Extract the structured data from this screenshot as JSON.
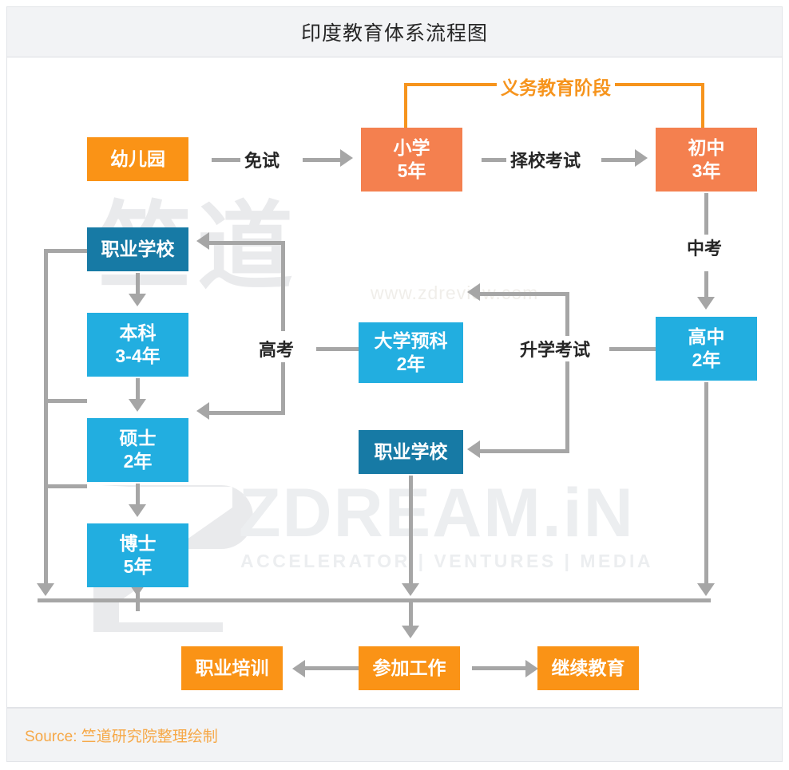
{
  "header": {
    "title": "印度教育体系流程图"
  },
  "footer": {
    "source": "Source: 竺道研究院整理绘制"
  },
  "watermark": {
    "brand_cn": "竺道",
    "brand_en": "ZDREAM.iN",
    "tagline": "ACCELERATOR | VENTURES | MEDIA",
    "url": "www.zdreview.com"
  },
  "colors": {
    "orange": "#fa9316",
    "coral": "#f4804f",
    "blue": "#22aee0",
    "dark_blue": "#177aa5",
    "connector": "#a6a6a6",
    "bracket": "#f6941d",
    "source_text": "#f6a847",
    "header_bg": "#f2f3f5"
  },
  "nodes": {
    "kindergarten": {
      "line1": "幼儿园",
      "line2": ""
    },
    "primary": {
      "line1": "小学",
      "line2": "5年"
    },
    "junior_high": {
      "line1": "初中",
      "line2": "3年"
    },
    "senior_high": {
      "line1": "高中",
      "line2": "2年"
    },
    "voc_school_mid": {
      "line1": "职业学校",
      "line2": ""
    },
    "pre_university": {
      "line1": "大学预科",
      "line2": "2年"
    },
    "voc_school_left": {
      "line1": "职业学校",
      "line2": ""
    },
    "bachelor": {
      "line1": "本科",
      "line2": "3-4年"
    },
    "master": {
      "line1": "硕士",
      "line2": "2年"
    },
    "doctor": {
      "line1": "博士",
      "line2": "5年"
    },
    "vocational_training": {
      "line1": "职业培训",
      "line2": ""
    },
    "employment": {
      "line1": "参加工作",
      "line2": ""
    },
    "continuing_education": {
      "line1": "继续教育",
      "line2": ""
    }
  },
  "edge_labels": {
    "compulsory_stage": "义务教育阶段",
    "no_exam": "免试",
    "school_choice_exam": "择校考试",
    "zhongkao": "中考",
    "gaokao": "高考",
    "advancement_exam": "升学考试"
  }
}
